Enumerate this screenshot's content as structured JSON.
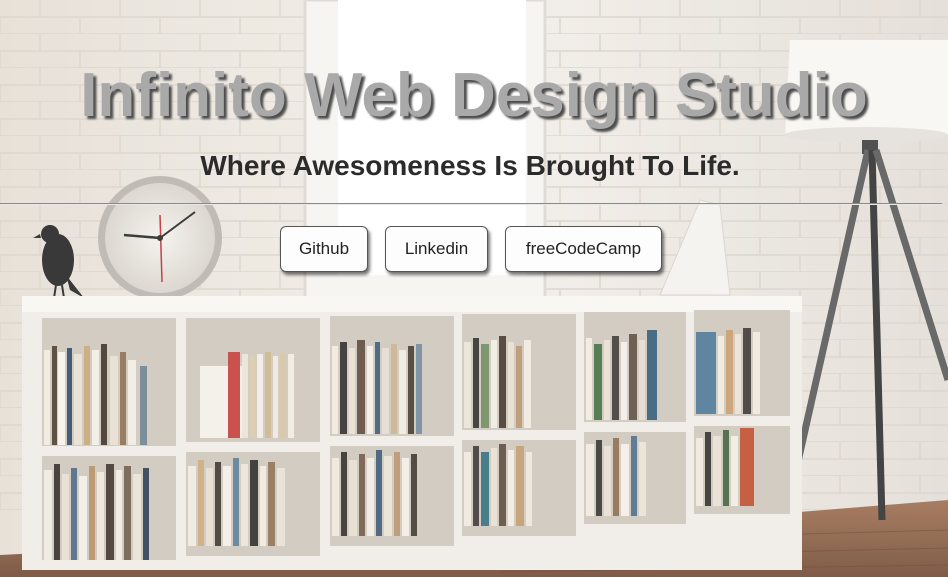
{
  "hero": {
    "title": "Infinito Web Design Studio",
    "subtitle": "Where Awesomeness Is Brought To Life."
  },
  "links": {
    "github_label": "Github",
    "linkedin_label": "Linkedin",
    "freecodecamp_label": "freeCodeCamp"
  },
  "colors": {
    "title": "#a9a9a9",
    "title_shadow": "#4d4d4d",
    "subtitle": "#2b2b2b",
    "button_bg": "#fdfdfd",
    "wall": "#ebe6de",
    "floor": "#8a5a3c"
  }
}
